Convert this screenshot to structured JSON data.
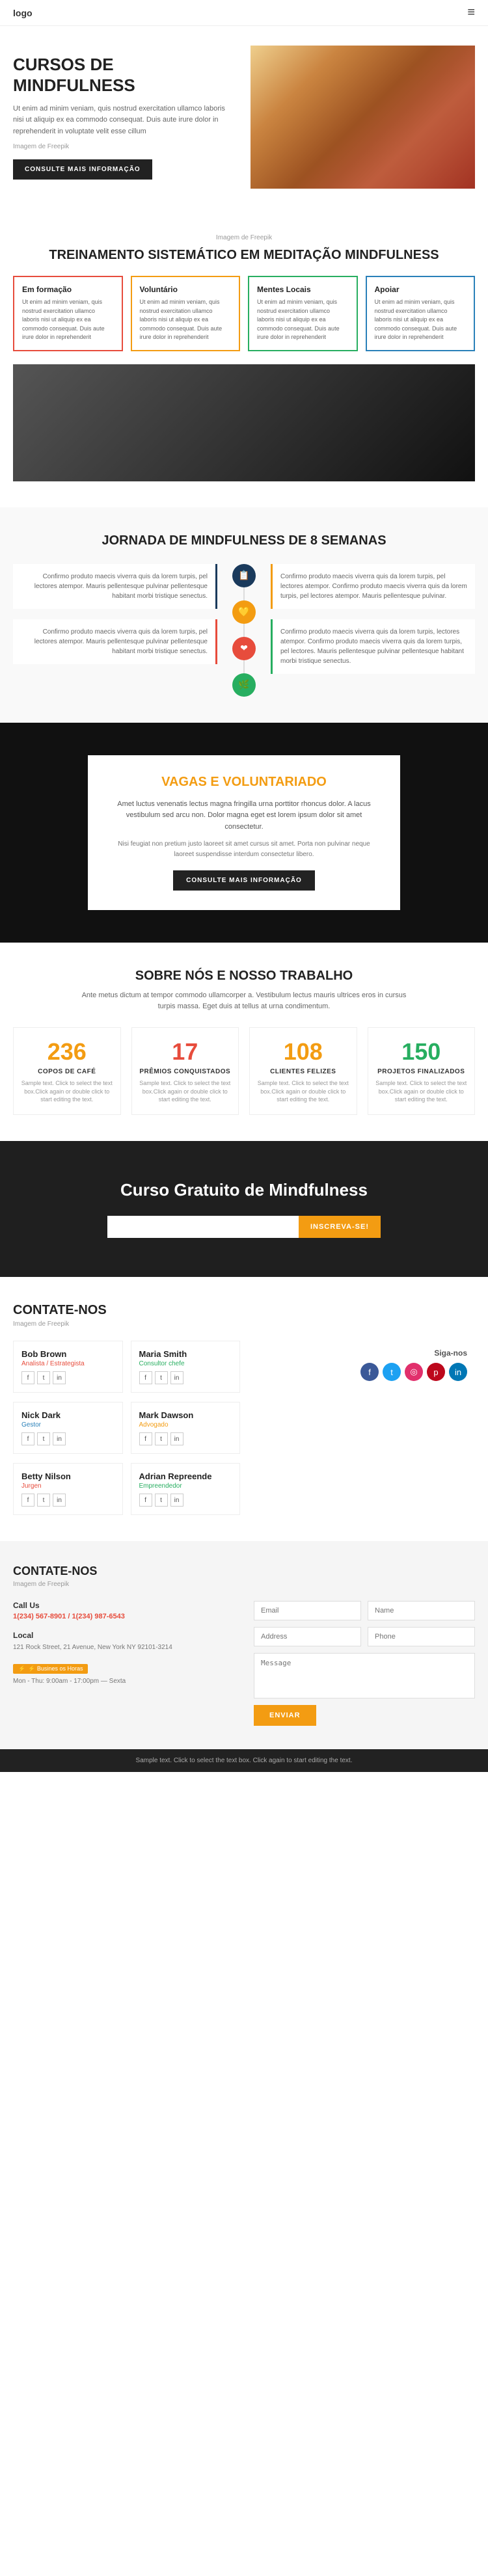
{
  "header": {
    "logo": "logo",
    "menu_icon": "≡"
  },
  "hero": {
    "title": "CURSOS DE\nMINDFULNESS",
    "description": "Ut enim ad minim veniam, quis nostrud exercitation ullamco laboris nisi ut aliquip ex ea commodo consequat. Duis aute irure dolor in reprehenderit in voluptate velit esse cillum",
    "image_credit": "Imagem de Freepik",
    "button": "CONSULTE MAIS INFORMAÇÃO"
  },
  "training": {
    "image_credit": "Imagem de Freepik",
    "title": "TREINAMENTO SISTEMÁTICO EM MEDITAÇÃO MINDFULNESS",
    "cards": [
      {
        "title": "Em formação",
        "text": "Ut enim ad minim veniam, quis nostrud exercitation ullamco laboris nisi ut aliquip ex ea commodo consequat. Duis aute irure dolor in reprehenderit",
        "color": "red"
      },
      {
        "title": "Voluntário",
        "text": "Ut enim ad minim veniam, quis nostrud exercitation ullamco laboris nisi ut aliquip ex ea commodo consequat. Duis aute irure dolor in reprehenderit",
        "color": "yellow"
      },
      {
        "title": "Mentes Locais",
        "text": "Ut enim ad minim veniam, quis nostrud exercitation ullamco laboris nisi ut aliquip ex ea commodo consequat. Duis aute irure dolor in reprehenderit",
        "color": "green"
      },
      {
        "title": "Apoiar",
        "text": "Ut enim ad minim veniam, quis nostrud exercitation ullamco laboris nisi ut aliquip ex ea commodo consequat. Duis aute irure dolor in reprehenderit",
        "color": "blue"
      }
    ]
  },
  "jornada": {
    "title": "JORNADA DE MINDFULNESS DE 8 SEMANAS",
    "items_left": [
      {
        "text": "Confirmo produto maecis viverra quis da lorem turpis, pel lectores atempor. Mauris pellentesque pulvinar pellentesque habitant morbi tristique senectus."
      },
      {
        "text": "Confirmo produto maecis viverra quis da lorem turpis, pel lectores atempor. Mauris pellentesque pulvinar pellentesque habitant morbi tristique senectus."
      }
    ],
    "items_right": [
      {
        "text": "Confirmo produto maecis viverra quis da lorem turpis, pel lectores atempor. Confirmo produto maecis viverra quis da lorem turpis, pel lectores atempor. Mauris pellentesque pulvinar."
      },
      {
        "text": "Confirmo produto maecis viverra quis da lorem turpis, lectores atempor. Confirmo produto maecis viverra quis da lorem turpis, pel lectores. Mauris pellentesque pulvinar pellentesque habitant morbi tristique senectus."
      }
    ],
    "icons": [
      {
        "symbol": "📋",
        "type": "blue-dark"
      },
      {
        "symbol": "🧡",
        "type": "orange"
      },
      {
        "symbol": "❤️",
        "type": "red"
      },
      {
        "symbol": "🌿",
        "type": "green"
      }
    ]
  },
  "vagas": {
    "title": "VAGAS E VOLUNTARIADO",
    "text1": "Amet luctus venenatis lectus magna fringilla urna porttitor rhoncus dolor. A lacus vestibulum sed arcu non. Dolor magna eget est lorem ipsum dolor sit amet consectetur.",
    "text2": "Nisi feugiat non pretium justo laoreet sit amet cursus sit amet. Porta non pulvinar neque laoreet suspendisse interdum consectetur libero.",
    "button": "CONSULTE MAIS INFORMAÇÃO"
  },
  "sobre": {
    "title": "SOBRE NÓS E NOSSO TRABALHO",
    "subtitle": "Ante metus dictum at tempor commodo ullamcorper a. Vestibulum lectus mauris ultrices eros in cursus turpis massa. Eget duis at tellus at urna condimentum.",
    "stats": [
      {
        "number": "236",
        "label": "COPOS DE CAFÉ",
        "desc": "Sample text. Click to select the text box.Click again or double click to start editing the text."
      },
      {
        "number": "17",
        "label": "PRÊMIOS CONQUISTADOS",
        "desc": "Sample text. Click to select the text box.Click again or double click to start editing the text."
      },
      {
        "number": "108",
        "label": "CLIENTES FELIZES",
        "desc": "Sample text. Click to select the text box.Click again or double click to start editing the text."
      },
      {
        "number": "150",
        "label": "PROJETOS FINALIZADOS",
        "desc": "Sample text. Click to select the text box.Click again or double click to start editing the text."
      }
    ]
  },
  "curso": {
    "title": "Curso Gratuito de Mindfulness",
    "input_placeholder": "",
    "button": "Inscreva-se!"
  },
  "contate": {
    "title": "CONTATE-NOS",
    "credit": "Imagem de Freepik",
    "contacts": [
      {
        "name": "Bob Brown",
        "role": "Analista / Estrategista",
        "role_color": "red"
      },
      {
        "name": "Maria Smith",
        "role": "Consultor chefe",
        "role_color": "green"
      },
      {
        "name": "Nick Dark",
        "role": "Gestor",
        "role_color": "blue"
      },
      {
        "name": "Mark Dawson",
        "role": "Advogado",
        "role_color": "orange"
      },
      {
        "name": "Betty Nilson",
        "role": "Jurgen",
        "role_color": "red"
      },
      {
        "name": "Adrian Repreende",
        "role": "Empreendedor",
        "role_color": "green"
      }
    ],
    "social_label": "Siga-nos",
    "social_icons": [
      "f",
      "t",
      "i",
      "p",
      "in"
    ]
  },
  "contate2": {
    "title": "CONTATE-NOS",
    "credit": "Imagem de Freepik",
    "call_us": {
      "title": "Call Us",
      "phone": "1(234) 567-8901 / 1(234) 987-6543"
    },
    "local": {
      "title": "Local",
      "address": "121 Rock Street, 21 Avenue, New York NY 92101-3214"
    },
    "hours_label": "⚡ Busines os Horas",
    "hours": "Mon - Thu: 9:00am - 17:00pm — Sexta",
    "form": {
      "email_label": "Email",
      "name_label": "Name",
      "address_label": "Address",
      "phone_label": "Phone",
      "message_label": "Message",
      "button": "ENVIAR"
    }
  },
  "footer": {
    "text": "Sample text. Click to select the text box. Click again to start editing the text."
  }
}
